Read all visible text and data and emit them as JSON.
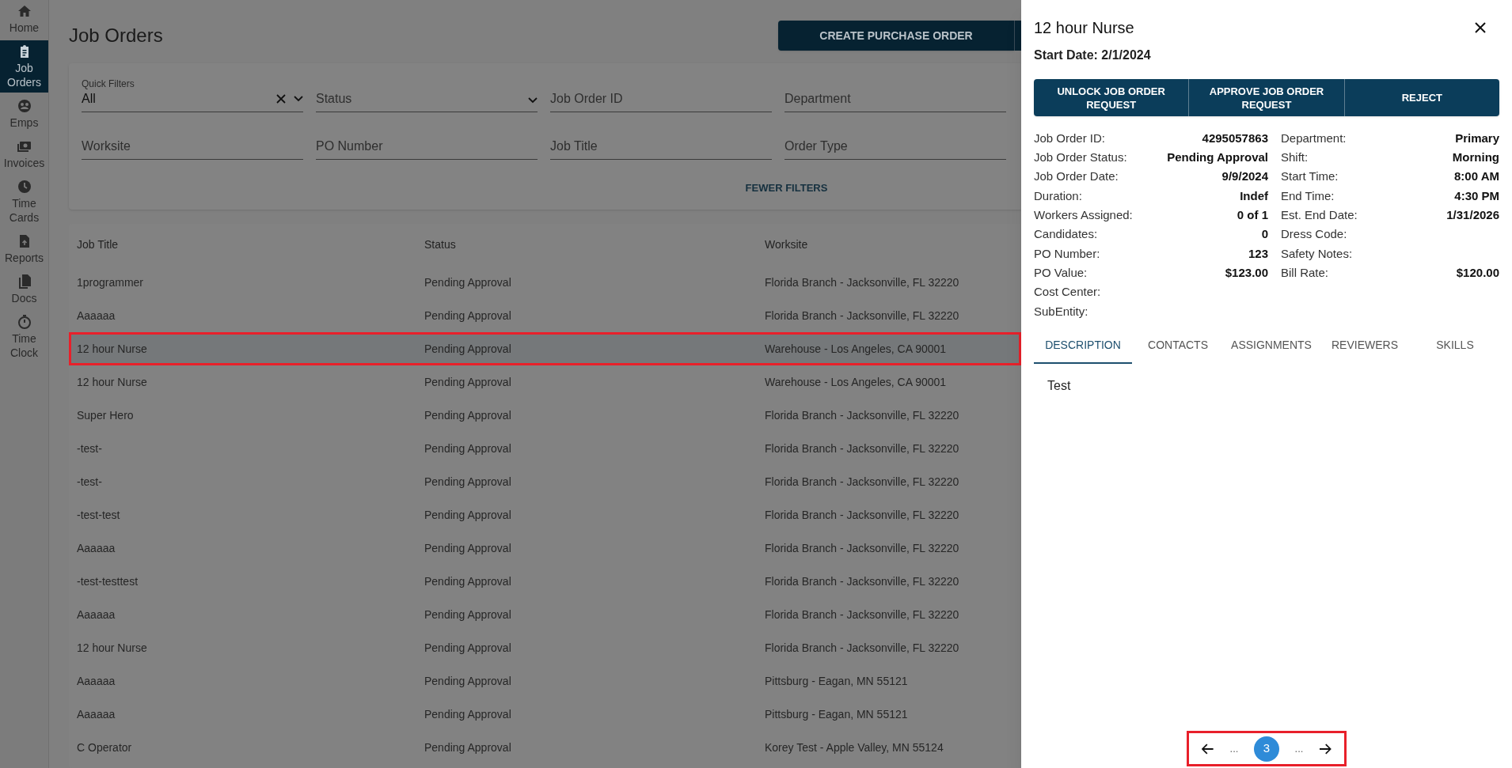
{
  "sidebar": {
    "items": [
      {
        "label": "Home",
        "selected": false
      },
      {
        "label": "Job Orders",
        "selected": true
      },
      {
        "label": "Emps",
        "selected": false
      },
      {
        "label": "Invoices",
        "selected": false
      },
      {
        "label": "Time Cards",
        "selected": false
      },
      {
        "label": "Reports",
        "selected": false
      },
      {
        "label": "Docs",
        "selected": false
      },
      {
        "label": "Time Clock",
        "selected": false
      }
    ]
  },
  "page_title": "Job Orders",
  "create_button": "CREATE PURCHASE ORDER",
  "filters": {
    "quick_filter": {
      "label": "Quick Filters",
      "value": "All"
    },
    "fields": [
      {
        "kind": "select",
        "placeholder": "Status"
      },
      {
        "kind": "text",
        "placeholder": "Job Order ID"
      },
      {
        "kind": "text",
        "placeholder": "Department"
      },
      {
        "kind": "text",
        "placeholder": "Worksite"
      },
      {
        "kind": "text",
        "placeholder": "PO Number"
      },
      {
        "kind": "text",
        "placeholder": "Job Title"
      },
      {
        "kind": "text",
        "placeholder": "Order Type"
      }
    ],
    "toggle": "FEWER FILTERS"
  },
  "table": {
    "columns": [
      "Job Title",
      "Status",
      "Worksite"
    ],
    "rows": [
      {
        "cells": [
          "1programmer",
          "Pending Approval",
          "Florida Branch - Jacksonville, FL 32220"
        ],
        "selected": false
      },
      {
        "cells": [
          "Aaaaaa",
          "Pending Approval",
          "Florida Branch - Jacksonville, FL 32220"
        ],
        "selected": false
      },
      {
        "cells": [
          "12 hour Nurse",
          "Pending Approval",
          "Warehouse - Los Angeles, CA 90001"
        ],
        "selected": true
      },
      {
        "cells": [
          "12 hour Nurse",
          "Pending Approval",
          "Warehouse - Los Angeles, CA 90001"
        ],
        "selected": false
      },
      {
        "cells": [
          "Super Hero",
          "Pending Approval",
          "Florida Branch - Jacksonville, FL 32220"
        ],
        "selected": false
      },
      {
        "cells": [
          "-test-",
          "Pending Approval",
          "Florida Branch - Jacksonville, FL 32220"
        ],
        "selected": false
      },
      {
        "cells": [
          "-test-",
          "Pending Approval",
          "Florida Branch - Jacksonville, FL 32220"
        ],
        "selected": false
      },
      {
        "cells": [
          "-test-test",
          "Pending Approval",
          "Florida Branch - Jacksonville, FL 32220"
        ],
        "selected": false
      },
      {
        "cells": [
          "Aaaaaa",
          "Pending Approval",
          "Florida Branch - Jacksonville, FL 32220"
        ],
        "selected": false
      },
      {
        "cells": [
          "-test-testtest",
          "Pending Approval",
          "Florida Branch - Jacksonville, FL 32220"
        ],
        "selected": false
      },
      {
        "cells": [
          "Aaaaaa",
          "Pending Approval",
          "Florida Branch - Jacksonville, FL 32220"
        ],
        "selected": false
      },
      {
        "cells": [
          "12 hour Nurse",
          "Pending Approval",
          "Florida Branch - Jacksonville, FL 32220"
        ],
        "selected": false
      },
      {
        "cells": [
          "Aaaaaa",
          "Pending Approval",
          "Pittsburg - Eagan, MN 55121"
        ],
        "selected": false
      },
      {
        "cells": [
          "Aaaaaa",
          "Pending Approval",
          "Pittsburg - Eagan, MN 55121"
        ],
        "selected": false
      },
      {
        "cells": [
          "C Operator",
          "Pending Approval",
          "Korey Test - Apple Valley, MN 55124"
        ],
        "selected": false
      }
    ]
  },
  "panel": {
    "title": "12 hour Nurse",
    "start_date": "Start Date: 2/1/2024",
    "actions": [
      "UNLOCK JOB ORDER REQUEST",
      "APPROVE JOB ORDER REQUEST",
      "REJECT"
    ],
    "details_left": [
      {
        "label": "Job Order ID:",
        "value": "4295057863"
      },
      {
        "label": "Job Order Status:",
        "value": "Pending Approval"
      },
      {
        "label": "Job Order Date:",
        "value": "9/9/2024"
      },
      {
        "label": "Duration:",
        "value": "Indef"
      },
      {
        "label": "Workers Assigned:",
        "value": "0 of 1"
      },
      {
        "label": "Candidates:",
        "value": "0"
      },
      {
        "label": "PO Number:",
        "value": "123"
      },
      {
        "label": "PO Value:",
        "value": "$123.00"
      },
      {
        "label": "Cost Center:"
      },
      {
        "label": "SubEntity:"
      }
    ],
    "details_right": [
      {
        "label": "Department:",
        "value": "Primary"
      },
      {
        "label": "Shift:",
        "value": "Morning"
      },
      {
        "label": "Start Time:",
        "value": "8:00 AM"
      },
      {
        "label": "End Time:",
        "value": "4:30 PM"
      },
      {
        "label": "Est. End Date:",
        "value": "1/31/2026"
      },
      {
        "label": "Dress Code:"
      },
      {
        "label": "Safety Notes:"
      },
      {
        "label": "Bill Rate:",
        "value": "$120.00"
      }
    ],
    "tabs": [
      {
        "label": "DESCRIPTION",
        "selected": true
      },
      {
        "label": "CONTACTS",
        "selected": false
      },
      {
        "label": "ASSIGNMENTS",
        "selected": false
      },
      {
        "label": "REVIEWERS",
        "selected": false
      },
      {
        "label": "SKILLS",
        "selected": false
      }
    ],
    "description": "Test",
    "pagination": {
      "items": [
        {
          "kind": "ellipsis",
          "label": "..."
        },
        {
          "kind": "page",
          "label": "3",
          "selected": true
        },
        {
          "kind": "ellipsis",
          "label": "..."
        }
      ]
    }
  }
}
